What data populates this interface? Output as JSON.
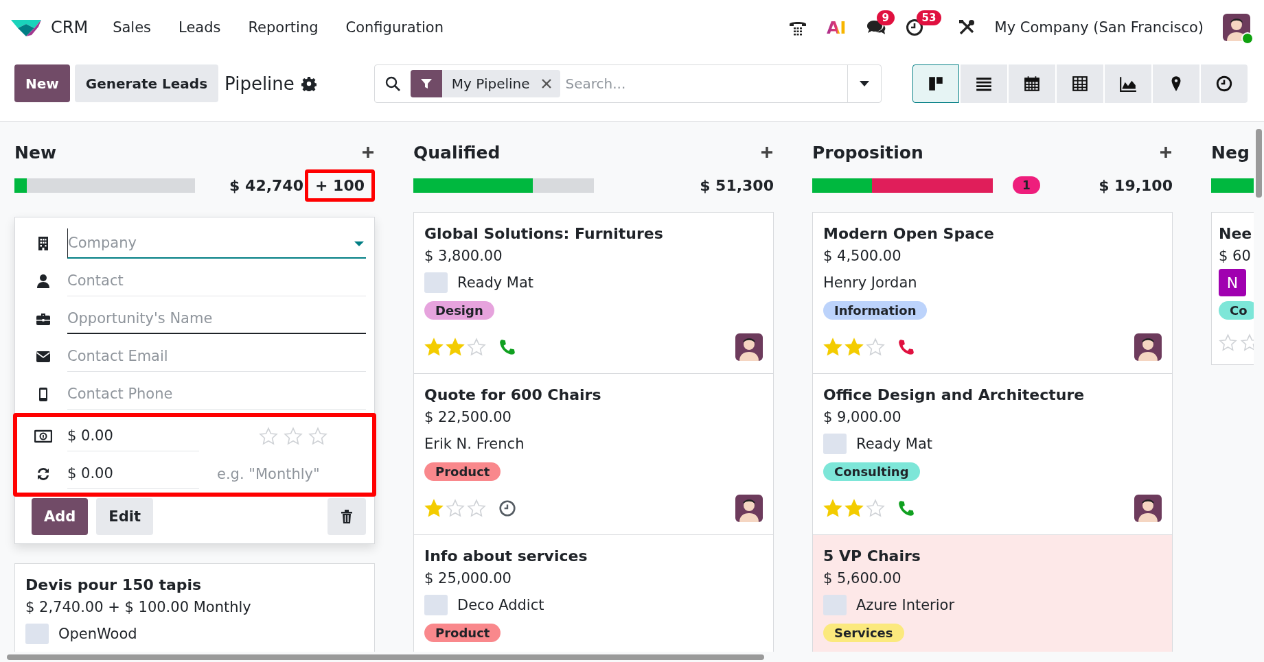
{
  "app": {
    "name": "CRM"
  },
  "menu": [
    {
      "label": "Sales"
    },
    {
      "label": "Leads"
    },
    {
      "label": "Reporting"
    },
    {
      "label": "Configuration"
    }
  ],
  "systray": {
    "ai_label": "AI",
    "messages_count": "9",
    "activities_count": "53",
    "company": "My Company (San Francisco)",
    "user_online": true
  },
  "control_panel": {
    "new_button": "New",
    "generate_button": "Generate Leads",
    "title": "Pipeline",
    "search": {
      "facet": "My Pipeline",
      "placeholder": "Search..."
    },
    "views": [
      {
        "kind": "kanban",
        "selected": true
      },
      {
        "kind": "list",
        "selected": false
      },
      {
        "kind": "calendar",
        "selected": false
      },
      {
        "kind": "pivot",
        "selected": false
      },
      {
        "kind": "graph",
        "selected": false
      },
      {
        "kind": "map",
        "selected": false
      },
      {
        "kind": "activity",
        "selected": false
      }
    ]
  },
  "columns": [
    {
      "title": "New",
      "progress": [
        {
          "color": "#00b83f",
          "level": 0.07
        }
      ],
      "total": "$ 42,740",
      "recurring": {
        "text": "+ 100",
        "highlighted": true
      },
      "quick_create": {
        "fields": [
          {
            "kind": "company",
            "placeholder": "Company",
            "focused": true,
            "required": false
          },
          {
            "kind": "contact",
            "placeholder": "Contact",
            "focused": false,
            "required": false
          },
          {
            "kind": "opportunity",
            "placeholder": "Opportunity's Name",
            "focused": false,
            "required": true
          },
          {
            "kind": "email",
            "placeholder": "Contact Email",
            "focused": false,
            "required": false
          },
          {
            "kind": "phone",
            "placeholder": "Contact Phone",
            "focused": false,
            "required": false
          }
        ],
        "revenue": {
          "highlighted": true,
          "expected": "$ 0.00",
          "stars": 0,
          "recurring": "$ 0.00",
          "plan_placeholder": "e.g. \"Monthly\""
        },
        "add_button": "Add",
        "edit_button": "Edit"
      },
      "cards": [
        {
          "title": "Devis pour 150 tapis",
          "amount": "$ 2,740.00 + $ 100.00 Monthly",
          "partner": {
            "name": "OpenWood",
            "logo": true
          }
        }
      ]
    },
    {
      "title": "Qualified",
      "progress": [
        {
          "color": "#00b83f",
          "level": 0.66
        }
      ],
      "total": "$ 51,300",
      "cards": [
        {
          "title": "Global Solutions: Furnitures",
          "amount": "$ 3,800.00",
          "partner": {
            "name": "Ready Mat",
            "logo": true
          },
          "tags": [
            {
              "label": "Design",
              "color": "#e6a3dd"
            }
          ],
          "stars": 2,
          "activity": {
            "kind": "call",
            "overdue": false
          },
          "assigned": true
        },
        {
          "title": "Quote for 600 Chairs",
          "amount": "$ 22,500.00",
          "partner": {
            "name": "Erik N. French",
            "logo": false
          },
          "tags": [
            {
              "label": "Product",
              "color": "#f9888c"
            }
          ],
          "stars": 1,
          "activity": {
            "kind": "none",
            "overdue": false
          },
          "assigned": true
        },
        {
          "title": "Info about services",
          "amount": "$ 25,000.00",
          "partner": {
            "name": "Deco Addict",
            "logo": true
          },
          "tags": [
            {
              "label": "Product",
              "color": "#f9888c"
            }
          ]
        }
      ]
    },
    {
      "title": "Proposition",
      "progress": [
        {
          "color": "#00b83f",
          "level": 0.33
        },
        {
          "color": "#e01e5a",
          "level": 0.67
        }
      ],
      "badge": "1",
      "total": "$ 19,100",
      "cards": [
        {
          "title": "Modern Open Space",
          "amount": "$ 4,500.00",
          "partner": {
            "name": "Henry Jordan",
            "logo": false
          },
          "tags": [
            {
              "label": "Information",
              "color": "#bcd3fb"
            }
          ],
          "stars": 2,
          "activity": {
            "kind": "call",
            "overdue": true
          },
          "assigned": true
        },
        {
          "title": "Office Design and Architecture",
          "amount": "$ 9,000.00",
          "partner": {
            "name": "Ready Mat",
            "logo": true
          },
          "tags": [
            {
              "label": "Consulting",
              "color": "#7de6d8"
            }
          ],
          "stars": 2,
          "activity": {
            "kind": "call",
            "overdue": false
          },
          "assigned": true
        },
        {
          "title": "5 VP Chairs",
          "amount": "$ 5,600.00",
          "partner": {
            "name": "Azure Interior",
            "logo": true
          },
          "tags": [
            {
              "label": "Services",
              "color": "#fbe97d"
            }
          ],
          "alert": true
        }
      ]
    },
    {
      "title": "Neg",
      "progress": [
        {
          "color": "#00b83f",
          "level": 1
        }
      ],
      "cards": [
        {
          "title": "Nee",
          "amount": "$ 60",
          "partner": {
            "initial": "N"
          },
          "tags": [
            {
              "label": "Co",
              "color": "#7de6d8"
            }
          ],
          "rating_shown": true
        }
      ]
    }
  ]
}
